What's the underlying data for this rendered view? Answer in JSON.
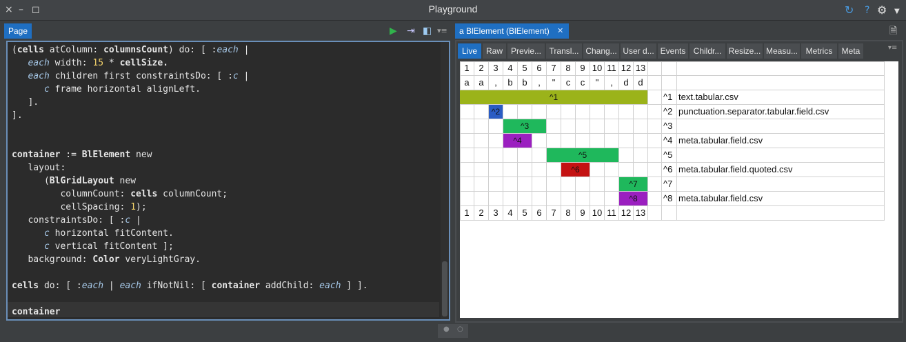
{
  "window": {
    "title": "Playground",
    "controls": [
      "×",
      "–",
      "◻"
    ]
  },
  "toolbar_icons": [
    "refresh-icon",
    "help-icon",
    "gear-icon",
    "dropdown-icon"
  ],
  "left": {
    "tab": "Page",
    "editor_lines": [
      [
        {
          "t": "("
        },
        {
          "t": "cells",
          "c": "kw"
        },
        {
          "t": " atColumn: "
        },
        {
          "t": "columnsCount",
          "c": "kw"
        },
        {
          "t": ") do: [ :"
        },
        {
          "t": "each",
          "c": "it"
        },
        {
          "t": " |"
        }
      ],
      [
        {
          "t": "   "
        },
        {
          "t": "each",
          "c": "it"
        },
        {
          "t": " width: "
        },
        {
          "t": "15",
          "c": "num"
        },
        {
          "t": " * "
        },
        {
          "t": "cellSize.",
          "c": "kw"
        }
      ],
      [
        {
          "t": "   "
        },
        {
          "t": "each",
          "c": "it"
        },
        {
          "t": " children first constraintsDo: [ :"
        },
        {
          "t": "c",
          "c": "it"
        },
        {
          "t": " |"
        }
      ],
      [
        {
          "t": "      "
        },
        {
          "t": "c",
          "c": "it"
        },
        {
          "t": " frame horizontal alignLeft."
        }
      ],
      [
        {
          "t": "   ]."
        }
      ],
      [
        {
          "t": "]."
        }
      ],
      [
        {
          "t": ""
        }
      ],
      [
        {
          "t": ""
        }
      ],
      [
        {
          "t": "container",
          "c": "kw"
        },
        {
          "t": " := "
        },
        {
          "t": "BlElement",
          "c": "kw"
        },
        {
          "t": " new"
        }
      ],
      [
        {
          "t": "   layout:"
        }
      ],
      [
        {
          "t": "      ("
        },
        {
          "t": "BlGridLayout",
          "c": "kw"
        },
        {
          "t": " new"
        }
      ],
      [
        {
          "t": "         columnCount: "
        },
        {
          "t": "cells",
          "c": "kw"
        },
        {
          "t": " columnCount;"
        }
      ],
      [
        {
          "t": "         cellSpacing: "
        },
        {
          "t": "1",
          "c": "num"
        },
        {
          "t": ");"
        }
      ],
      [
        {
          "t": "   constraintsDo: [ :"
        },
        {
          "t": "c",
          "c": "it"
        },
        {
          "t": " |"
        }
      ],
      [
        {
          "t": "      "
        },
        {
          "t": "c",
          "c": "it"
        },
        {
          "t": " horizontal fitContent."
        }
      ],
      [
        {
          "t": "      "
        },
        {
          "t": "c",
          "c": "it"
        },
        {
          "t": " vertical fitContent ];"
        }
      ],
      [
        {
          "t": "   background: "
        },
        {
          "t": "Color",
          "c": "kw"
        },
        {
          "t": " veryLightGray."
        }
      ],
      [
        {
          "t": ""
        }
      ],
      [
        {
          "t": "cells",
          "c": "kw"
        },
        {
          "t": " do: [ :"
        },
        {
          "t": "each",
          "c": "it"
        },
        {
          "t": " | "
        },
        {
          "t": "each",
          "c": "it"
        },
        {
          "t": " ifNotNil: [ "
        },
        {
          "t": "container",
          "c": "kw"
        },
        {
          "t": " addChild: "
        },
        {
          "t": "each",
          "c": "it"
        },
        {
          "t": " ] ]."
        }
      ],
      [
        {
          "t": ""
        }
      ],
      [
        {
          "t": "container",
          "c": "kw"
        }
      ]
    ]
  },
  "right": {
    "tab": "a BlElement (BlElement)",
    "close": "✕",
    "subtabs": [
      "Live",
      "Raw",
      "Previe...",
      "Transl...",
      "Chang...",
      "User d...",
      "Events",
      "Childr...",
      "Resize...",
      "Measu...",
      "Metrics",
      "Meta"
    ],
    "active_subtab": "Live",
    "columns": [
      "1",
      "2",
      "3",
      "4",
      "5",
      "6",
      "7",
      "8",
      "9",
      "10",
      "11",
      "12",
      "13"
    ],
    "chars": [
      "a",
      "a",
      ",",
      "b",
      "b",
      ",",
      "\"",
      "c",
      "c",
      "\"",
      ",",
      "d",
      "d"
    ],
    "rows": [
      {
        "label": "^1",
        "name": "text.tabular.csv",
        "start": 1,
        "end": 13,
        "color": "#9bb31a"
      },
      {
        "label": "^2",
        "name": "punctuation.separator.tabular.field.csv",
        "start": 3,
        "end": 3,
        "color": "#2a5cc4"
      },
      {
        "label": "^3",
        "name": "",
        "start": 4,
        "end": 6,
        "color": "#1fb85c"
      },
      {
        "label": "^4",
        "name": "meta.tabular.field.csv",
        "start": 4,
        "end": 5,
        "color": "#9b1fc0"
      },
      {
        "label": "^5",
        "name": "",
        "start": 7,
        "end": 11,
        "color": "#1fb85c"
      },
      {
        "label": "^6",
        "name": "meta.tabular.field.quoted.csv",
        "start": 8,
        "end": 9,
        "color": "#c41212"
      },
      {
        "label": "^7",
        "name": "",
        "start": 12,
        "end": 13,
        "color": "#1fb85c"
      },
      {
        "label": "^8",
        "name": "meta.tabular.field.csv",
        "start": 12,
        "end": 13,
        "color": "#9b1fc0"
      }
    ]
  }
}
